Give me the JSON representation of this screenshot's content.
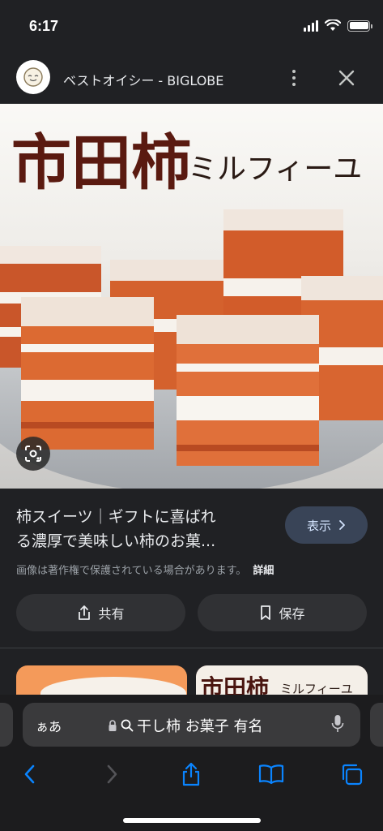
{
  "status": {
    "time": "6:17"
  },
  "header": {
    "site_title": "ベストオイシー - BIGLOBE"
  },
  "image": {
    "calligraphy": "市田柿",
    "product_label": "ミルフィーユ"
  },
  "result": {
    "title_line1": "柿スイーツ｜ギフトに喜ばれ",
    "title_line2": "る濃厚で美味しい柿のお菓...",
    "view_label": "表示",
    "copyright": "画像は著作権で保護されている場合があります。",
    "details_label": "詳細"
  },
  "actions": {
    "share_label": "共有",
    "save_label": "保存"
  },
  "related": {
    "thumb2_calligraphy": "市田柿",
    "thumb2_label": "ミルフィーユ"
  },
  "safari": {
    "aa_label": "ぁあ",
    "query": "干し柿 お菓子 有名"
  },
  "colors": {
    "accent_blue": "#0a84ff",
    "view_button_bg": "#394457",
    "background": "#202124"
  }
}
